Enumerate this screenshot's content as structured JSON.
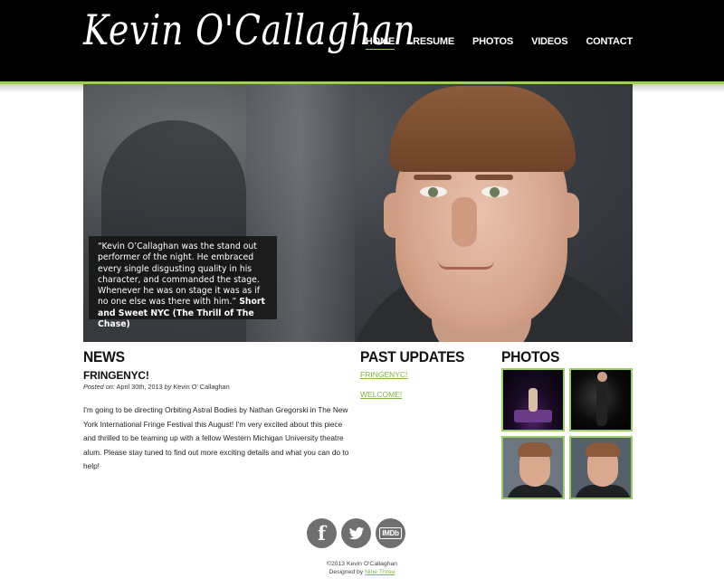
{
  "site": {
    "logo": "Kevin O'Callaghan",
    "accent_color": "#9ccc65"
  },
  "nav": {
    "items": [
      {
        "label": "HOME",
        "active": true
      },
      {
        "label": "RESUME"
      },
      {
        "label": "PHOTOS"
      },
      {
        "label": "VIDEOS"
      },
      {
        "label": "CONTACT"
      }
    ]
  },
  "hero": {
    "quote": "“Kevin O’Callaghan was the stand out performer of the night. He embraced every single disgusting quality in his character, and commanded the stage. Whenever he was on stage it was as if no one else was there with him.”",
    "attribution": "Short and Sweet NYC (The Thrill of The Chase)"
  },
  "news": {
    "heading": "NEWS",
    "post": {
      "title": "FRINGENYC!",
      "meta_label": "Posted on:",
      "date": "April 30th, 2013",
      "by_label": "by",
      "author": "Kevin O' Callaghan",
      "body": "I'm going to be directing Orbiting Astral Bodies by Nathan Gregorski in The New York International Fringe Festival this August! I'm very excited about this piece and thrilled to be teaming up with a fellow Western Michigan University theatre alum. Please stay tuned to find out more exciting details and what you can do to help!"
    }
  },
  "past_updates": {
    "heading": "PAST UPDATES",
    "links": [
      "FRINGENYC!",
      "WELCOME!"
    ]
  },
  "photos": {
    "heading": "PHOTOS"
  },
  "social": {
    "icons": [
      "facebook-icon",
      "twitter-icon",
      "imdb-icon"
    ],
    "facebook_glyph": "f",
    "imdb_label": "IMDb"
  },
  "footer": {
    "copyright": "©2013 Kevin O'Callaghan",
    "designed_by_label": "Designed by",
    "designer": "Nine Three"
  }
}
